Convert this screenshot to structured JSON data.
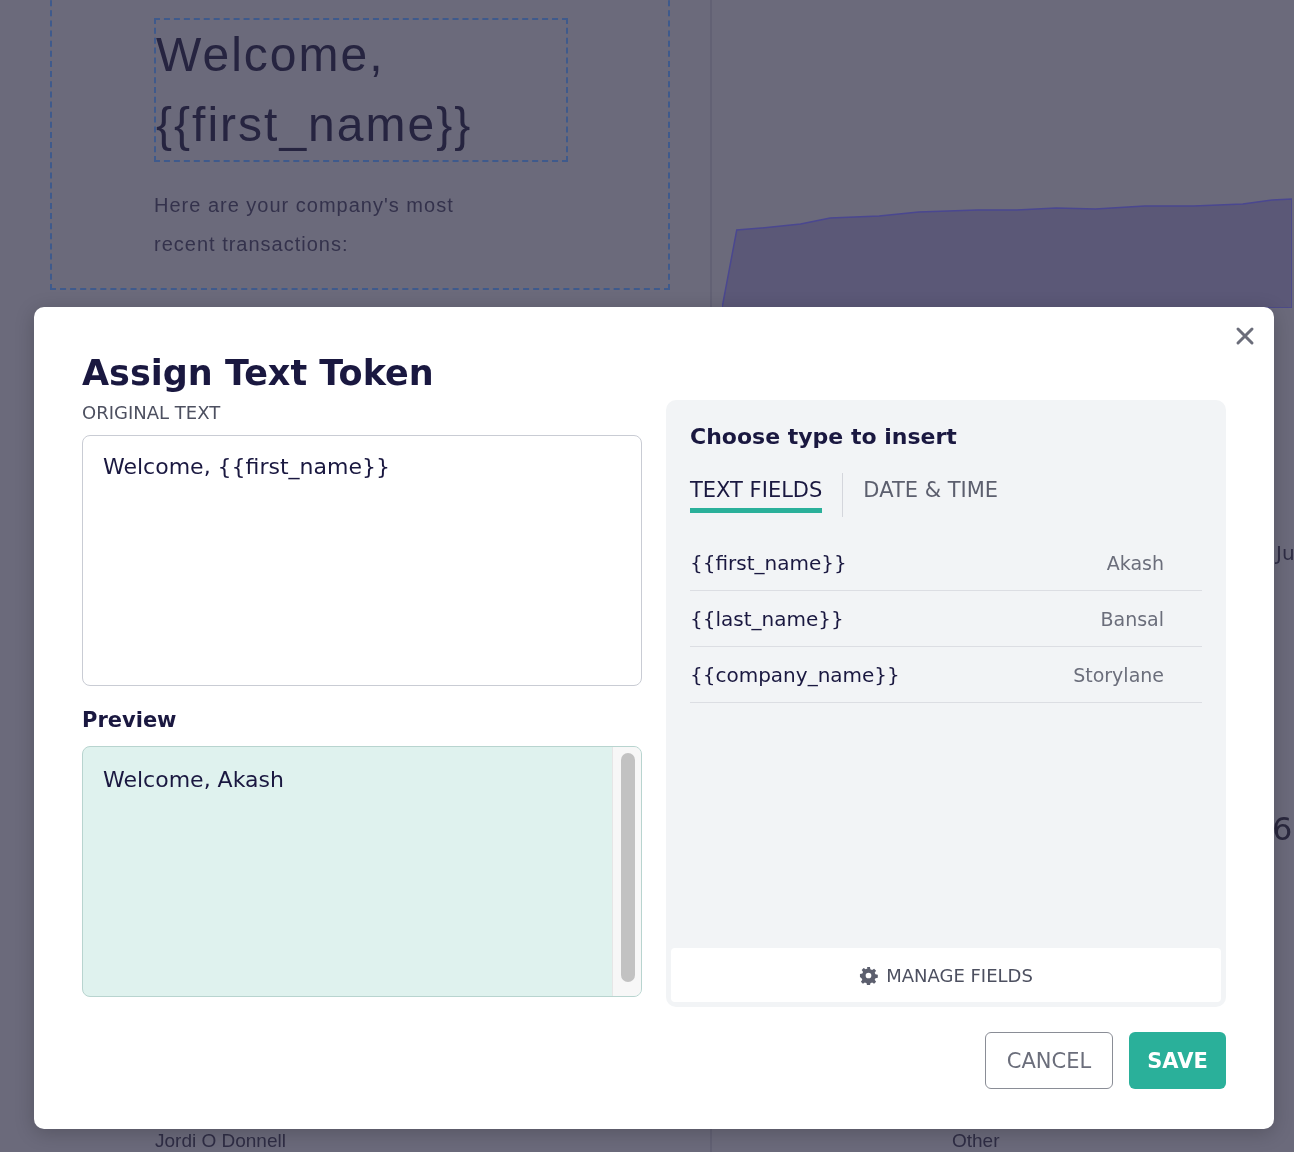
{
  "background_page": {
    "heading": "Welcome, {{first_name}}",
    "intro": "Here are your company's most recent transactions:",
    "row_name": "Jordi O Donnell",
    "row_category": "Other",
    "axis_label": "Ju",
    "value_fragment": "6"
  },
  "dialog": {
    "title": "Assign Text Token",
    "original_text_label": "ORIGINAL TEXT",
    "original_text": "Welcome, {{first_name}}",
    "preview_label": "Preview",
    "preview_text": "Welcome, Akash",
    "panel_title": "Choose type to insert",
    "tabs": [
      {
        "label": "TEXT FIELDS",
        "selected": true
      },
      {
        "label": "DATE & TIME",
        "selected": false
      }
    ],
    "fields": [
      {
        "token": "{{first_name}}",
        "value": "Akash"
      },
      {
        "token": "{{last_name}}",
        "value": "Bansal"
      },
      {
        "token": "{{company_name}}",
        "value": "Storylane"
      }
    ],
    "manage_button": "MANAGE FIELDS",
    "cancel_button": "CANCEL",
    "save_button": "SAVE"
  }
}
